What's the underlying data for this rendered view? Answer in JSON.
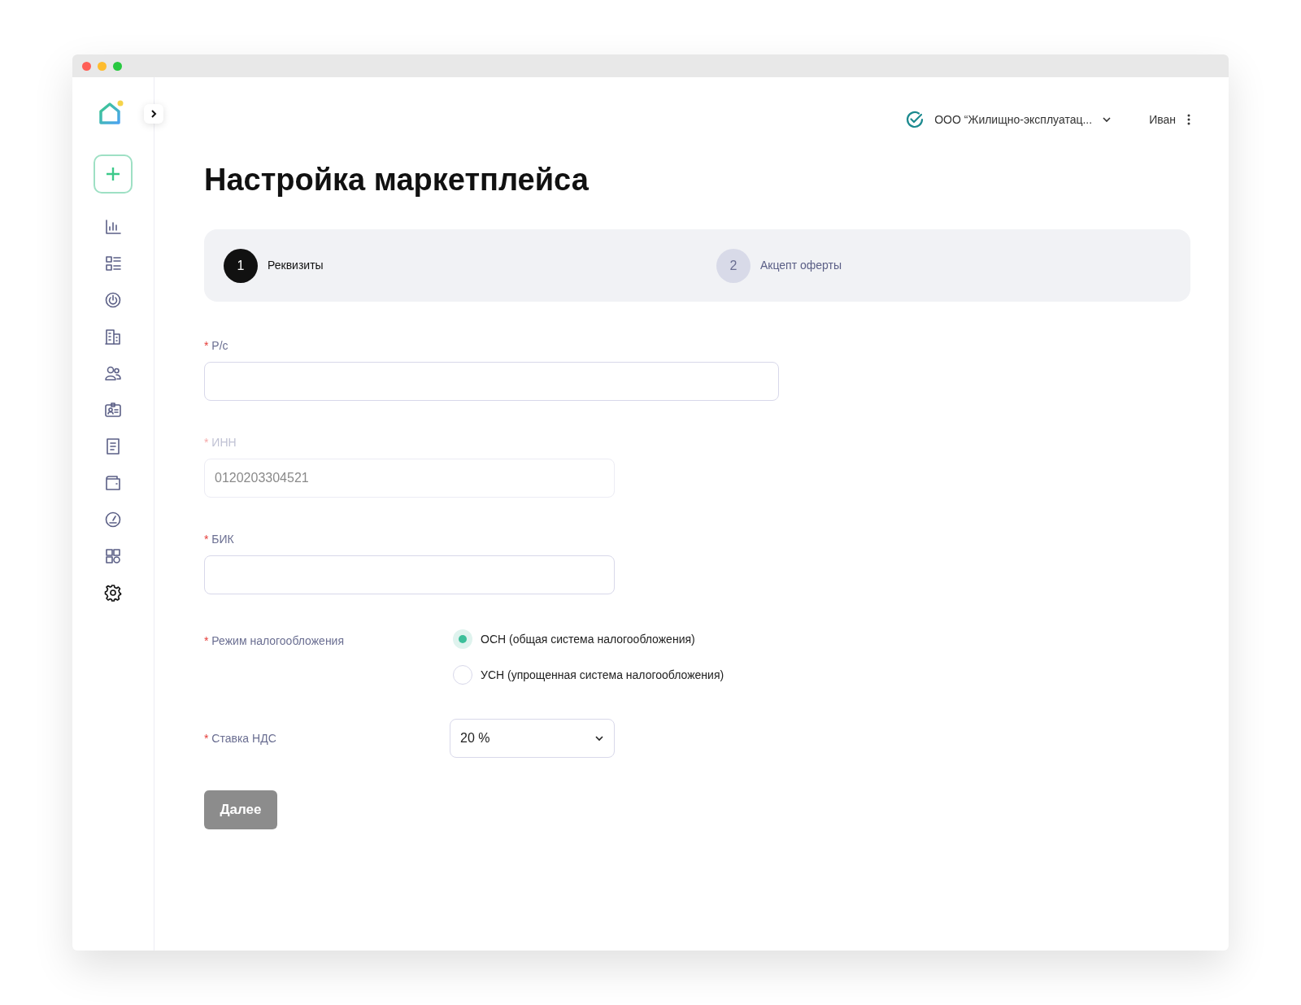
{
  "sidebar": {
    "items": [
      {
        "selected": false
      },
      {
        "selected": false
      },
      {
        "selected": false
      },
      {
        "selected": false
      },
      {
        "selected": false
      },
      {
        "selected": false
      },
      {
        "selected": false
      },
      {
        "selected": false
      },
      {
        "selected": false
      },
      {
        "selected": false
      },
      {
        "selected": true
      }
    ]
  },
  "header": {
    "organization": "ООО “Жилищно-эксплуатац...",
    "user": "Иван"
  },
  "title": "Настройка маркетплейса",
  "steps": [
    {
      "number": "1",
      "label": "Реквизиты",
      "selected": true
    },
    {
      "number": "2",
      "label": "Акцепт оферты",
      "selected": false
    }
  ],
  "fields": [
    {
      "kind": "text",
      "label": "Р/с",
      "required_mark": "*",
      "disabled": false,
      "wide": true
    },
    {
      "kind": "text",
      "label": "ИНН",
      "required_mark": "*",
      "disabled": true,
      "value": "0120203304521"
    },
    {
      "kind": "text",
      "label": "БИК",
      "required_mark": "*",
      "disabled": false
    },
    {
      "kind": "radio",
      "label": "Режим налогообложения",
      "required_mark": "*",
      "options": [
        {
          "label": "ОСН (общая система налогообложения)",
          "selected": true
        },
        {
          "label": "УСН (упрощенная система налогообложения)",
          "selected": false
        }
      ]
    },
    {
      "kind": "select",
      "label": "Ставка НДС",
      "required_mark": "*",
      "value": "20 %"
    }
  ],
  "submit": {
    "label": "Далее",
    "disabled": true
  }
}
